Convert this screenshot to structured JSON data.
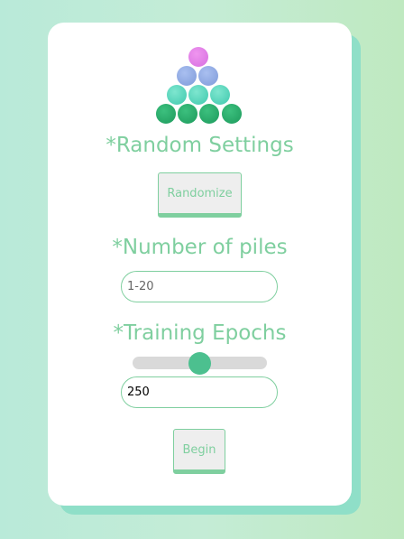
{
  "random_settings": {
    "heading": "*Random Settings",
    "randomize_label": "Randomize"
  },
  "piles": {
    "heading": "*Number of piles",
    "placeholder": "1-20",
    "value": ""
  },
  "training": {
    "heading": "*Training Epochs",
    "slider_fraction": 0.5,
    "value": "250"
  },
  "begin_label": "Begin",
  "colors": {
    "accent": "#7fcf9f",
    "slider_thumb": "#4cc08f",
    "card_shadow": "#8fdfc8",
    "logo_top": "#e27ce6",
    "logo_row2": "#8fa8e3",
    "logo_row3": "#4fd3b8",
    "logo_row4": "#22a866"
  },
  "logo": {
    "icon": "stacked-balls-triangle-icon"
  }
}
